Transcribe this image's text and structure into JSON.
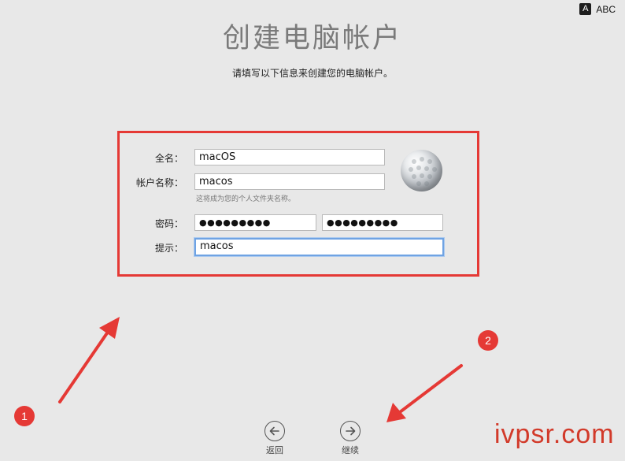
{
  "input_source": {
    "icon": "A",
    "label": "ABC"
  },
  "title": "创建电脑帐户",
  "subtitle": "请填写以下信息来创建您的电脑帐户。",
  "form": {
    "full_name": {
      "label": "全名：",
      "value": "macOS"
    },
    "account_name": {
      "label": "帐户名称：",
      "value": "macos",
      "hint": "这将成为您的个人文件夹名称。"
    },
    "password": {
      "label": "密码：",
      "value": "●●●●●●●●●",
      "verify_value": "●●●●●●●●●"
    },
    "hint": {
      "label": "提示：",
      "value": "macos"
    }
  },
  "avatar": {
    "icon": "golf-ball-icon"
  },
  "nav": {
    "back_label": "返回",
    "continue_label": "继续"
  },
  "annotations": {
    "badge1": "1",
    "badge2": "2",
    "watermark": "ivpsr.com",
    "color": "#e53935"
  }
}
